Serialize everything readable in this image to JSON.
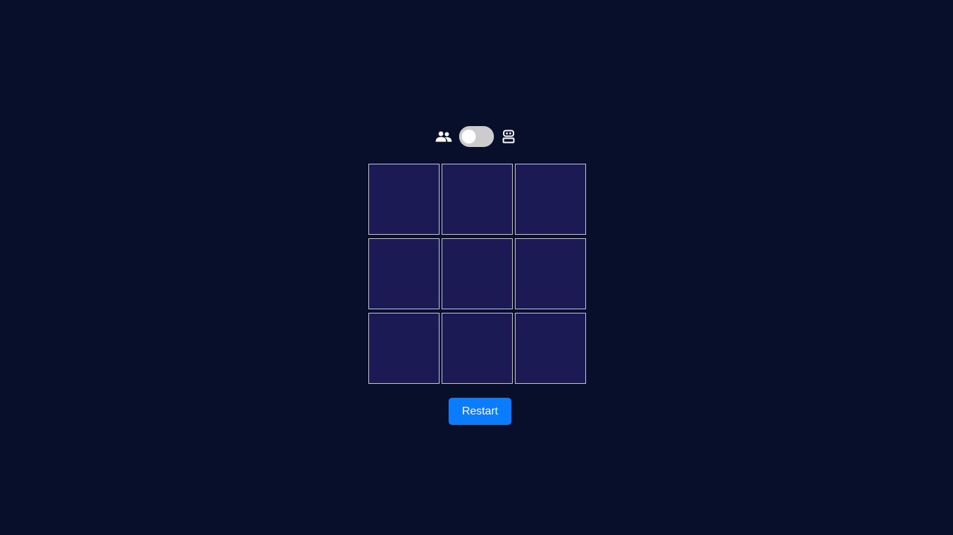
{
  "mode_switch": {
    "left_icon": "two-players-icon",
    "right_icon": "robot-icon",
    "state": "off"
  },
  "board": {
    "cells": [
      "",
      "",
      "",
      "",
      "",
      "",
      "",
      "",
      ""
    ]
  },
  "controls": {
    "restart_label": "Restart"
  },
  "colors": {
    "background": "#080f2b",
    "cell_fill": "#1c1a55",
    "cell_border": "#c8c8d6",
    "toggle_track": "#cccccc",
    "toggle_knob": "#ffffff",
    "button": "#0a7cff",
    "icon": "#ffffff"
  }
}
